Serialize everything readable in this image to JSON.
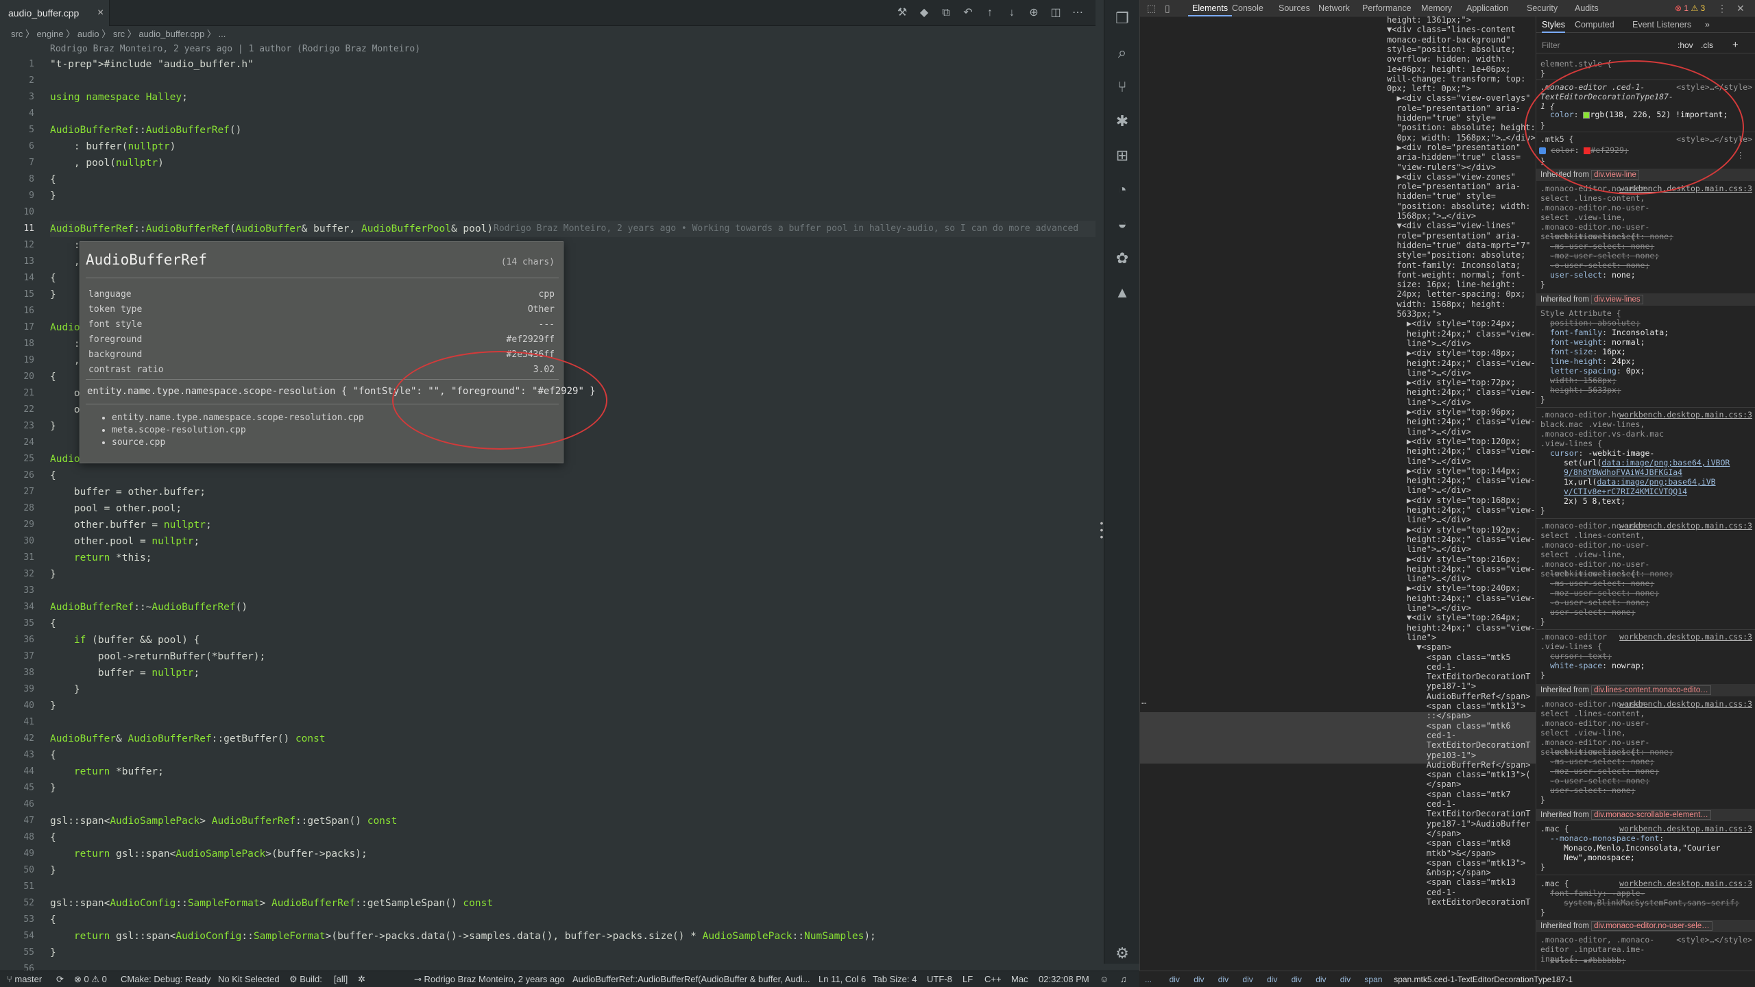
{
  "editor": {
    "tab": {
      "label": "audio_buffer.cpp",
      "close": "×"
    },
    "breadcrumb": "src 〉 engine 〉 audio 〉 src 〉 audio_buffer.cpp 〉 ...",
    "blame_header": "Rodrigo Braz Monteiro, 2 years ago | 1 author (Rodrigo Braz Monteiro)",
    "inline_blame": "Rodrigo Braz Monteiro, 2 years ago • Working towards a buffer pool in halley-audio, so I can do more advanced",
    "line_numbers": [
      "1",
      "2",
      "3",
      "4",
      "5",
      "6",
      "7",
      "8",
      "9",
      "10",
      "11",
      "12",
      "13",
      "14",
      "15",
      "16",
      "17",
      "18",
      "19",
      "20",
      "21",
      "22",
      "23",
      "24",
      "25",
      "26",
      "27",
      "28",
      "29",
      "30",
      "31",
      "32",
      "33",
      "34",
      "35",
      "36",
      "37",
      "38",
      "39",
      "40",
      "41",
      "42",
      "43",
      "44",
      "45",
      "46",
      "47",
      "48",
      "49",
      "50",
      "51",
      "52",
      "53",
      "54",
      "55",
      "56"
    ],
    "active_line": "11",
    "code": [
      "#include \"audio_buffer.h\"",
      "",
      "using namespace Halley;",
      "",
      "AudioBufferRef::AudioBufferRef()",
      "    : buffer(nullptr)",
      "    , pool(nullptr)",
      "{",
      "}",
      "",
      "AudioBufferRef::AudioBufferRef(AudioBuffer& buffer, AudioBufferPool& pool)",
      "    :",
      "    ,",
      "{",
      "}",
      "",
      "Audio",
      "    :",
      "    ,",
      "{",
      "    o",
      "    o",
      "}",
      "",
      "Audio",
      "{",
      "    buffer = other.buffer;",
      "    pool = other.pool;",
      "    other.buffer = nullptr;",
      "    other.pool = nullptr;",
      "    return *this;",
      "}",
      "",
      "AudioBufferRef::~AudioBufferRef()",
      "{",
      "    if (buffer && pool) {",
      "        pool->returnBuffer(*buffer);",
      "        buffer = nullptr;",
      "    }",
      "}",
      "",
      "AudioBuffer& AudioBufferRef::getBuffer() const",
      "{",
      "    return *buffer;",
      "}",
      "",
      "gsl::span<AudioSamplePack> AudioBufferRef::getSpan() const",
      "{",
      "    return gsl::span<AudioSamplePack>(buffer->packs);",
      "}",
      "",
      "gsl::span<AudioConfig::SampleFormat> AudioBufferRef::getSampleSpan() const",
      "{",
      "    return gsl::span<AudioConfig::SampleFormat>(buffer->packs.data()->samples.data(), buffer->packs.size() * AudioSamplePack::NumSamples);",
      "}",
      ""
    ],
    "hover": {
      "title": "AudioBufferRef",
      "chars": "(14 chars)",
      "rows": [
        {
          "k": "language",
          "v": "cpp"
        },
        {
          "k": "token type",
          "v": "Other"
        },
        {
          "k": "font style",
          "v": "---"
        },
        {
          "k": "foreground",
          "v": "#ef2929ff"
        },
        {
          "k": "background",
          "v": "#2e3436ff"
        },
        {
          "k": "contrast ratio",
          "v": "3.02"
        }
      ],
      "rule": "entity.name.type.namespace.scope-resolution { \"fontStyle\": \"\", \"foreground\": \"#ef2929\" }",
      "scopes": [
        "entity.name.type.namespace.scope-resolution.cpp",
        "meta.scope-resolution.cpp",
        "source.cpp"
      ]
    },
    "colors": {
      "background": "#2e3436",
      "scope_foreground": "#ef2929",
      "decoration_green": "#8ae234"
    }
  },
  "status": {
    "branch": "master",
    "sync": "⟳",
    "problems": "⊗ 0 ⚠ 0",
    "cmake": "CMake: Debug: Ready",
    "kit": "No Kit Selected",
    "build": "Build:",
    "target": "[all]",
    "blame": "Rodrigo Braz Monteiro, 2 years ago",
    "symbol": "AudioBufferRef::AudioBufferRef(AudioBuffer & buffer, Audi...",
    "position": "Ln 11, Col 6",
    "tabsize": "Tab Size: 4",
    "encoding": "UTF-8",
    "eol": "LF",
    "lang": "C++",
    "platform": "Mac",
    "time": "02:32:08 PM"
  },
  "devtools": {
    "tabs": [
      "Elements",
      "Console",
      "Sources",
      "Network",
      "Performance",
      "Memory",
      "Application",
      "Security",
      "Audits"
    ],
    "errors": "1",
    "warnings": "3",
    "style_tabs": [
      "Styles",
      "Computed",
      "Event Listeners"
    ],
    "filter_placeholder": "Filter",
    "hov": ":hov",
    "cls": ".cls",
    "breadcrumb": [
      "...",
      "div",
      "div",
      "div",
      "div",
      "div",
      "div",
      "div",
      "div",
      "span",
      "span.mtk5.ced-1-TextEditorDecorationType187-1"
    ],
    "dom_lines": [
      "height: 1361px;\">",
      "▼<div class=\"lines-content",
      "monaco-editor-background\"",
      "style=\"position: absolute;",
      "overflow: hidden; width:",
      "1e+06px; height: 1e+06px;",
      "will-change: transform; top:",
      "0px; left: 0px;\">",
      "  ▶<div class=\"view-overlays\"",
      "  role=\"presentation\" aria-",
      "  hidden=\"true\" style=",
      "  \"position: absolute; height:",
      "  0px; width: 1568px;\">…</div>",
      "  ▶<div role=\"presentation\"",
      "  aria-hidden=\"true\" class=",
      "  \"view-rulers\"></div>",
      "  ▶<div class=\"view-zones\"",
      "  role=\"presentation\" aria-",
      "  hidden=\"true\" style=",
      "  \"position: absolute; width:",
      "  1568px;\">…</div>",
      "  ▼<div class=\"view-lines\"",
      "  role=\"presentation\" aria-",
      "  hidden=\"true\" data-mprt=\"7\"",
      "  style=\"position: absolute;",
      "  font-family: Inconsolata;",
      "  font-weight: normal; font-",
      "  size: 16px; line-height:",
      "  24px; letter-spacing: 0px;",
      "  width: 1568px; height:",
      "  5633px;\">",
      "    ▶<div style=\"top:24px;",
      "    height:24px;\" class=\"view-",
      "    line\">…</div>",
      "    ▶<div style=\"top:48px;",
      "    height:24px;\" class=\"view-",
      "    line\">…</div>",
      "    ▶<div style=\"top:72px;",
      "    height:24px;\" class=\"view-",
      "    line\">…</div>",
      "    ▶<div style=\"top:96px;",
      "    height:24px;\" class=\"view-",
      "    line\">…</div>",
      "    ▶<div style=\"top:120px;",
      "    height:24px;\" class=\"view-",
      "    line\">…</div>",
      "    ▶<div style=\"top:144px;",
      "    height:24px;\" class=\"view-",
      "    line\">…</div>",
      "    ▶<div style=\"top:168px;",
      "    height:24px;\" class=\"view-",
      "    line\">…</div>",
      "    ▶<div style=\"top:192px;",
      "    height:24px;\" class=\"view-",
      "    line\">…</div>",
      "    ▶<div style=\"top:216px;",
      "    height:24px;\" class=\"view-",
      "    line\">…</div>",
      "    ▶<div style=\"top:240px;",
      "    height:24px;\" class=\"view-",
      "    line\">…</div>",
      "    ▼<div style=\"top:264px;",
      "    height:24px;\" class=\"view-",
      "    line\">",
      "      ▼<span>",
      "        <span class=\"mtk5",
      "        ced-1-",
      "        TextEditorDecorationT",
      "        ype187-1\">",
      "        AudioBufferRef</span>",
      "        <span class=\"mtk13\">",
      "        ::</span>",
      "        <span class=\"mtk6",
      "        ced-1-",
      "        TextEditorDecorationT",
      "        ype103-1\">",
      "        AudioBufferRef</span>",
      "        <span class=\"mtk13\">(",
      "        </span>",
      "        <span class=\"mtk7",
      "        ced-1-",
      "        TextEditorDecorationT",
      "        ype187-1\">AudioBuffer",
      "        </span>",
      "        <span class=\"mtk8",
      "        mtkb\">&</span>",
      "        <span class=\"mtk13\">",
      "        &nbsp;</span>",
      "        <span class=\"mtk13",
      "        ced-1-",
      "        TextEditorDecorationT"
    ],
    "styles": {
      "element_style": "element.style {",
      "rule1_selector": ".monaco-editor .ced-1-TextEditorDecorationType187-1 {",
      "rule1_source": "<style>…</style>",
      "rule1_prop": "color",
      "rule1_value": "rgb(138, 226, 52) !important;",
      "rule2_selector": ".mtk5 {",
      "rule2_source": "<style>…</style>",
      "rule2_prop": "color",
      "rule2_value": "#ef2929;",
      "inherited1": "div.view-line",
      "inherited2": "div.view-lines",
      "inherited3": "div.lines-content.monaco-edito…",
      "inherited4": "div.monaco-scrollable-element…",
      "inherited5": "div.monaco-editor.no-user-sele…",
      "source_css": "workbench.desktop.main.css:3"
    }
  }
}
